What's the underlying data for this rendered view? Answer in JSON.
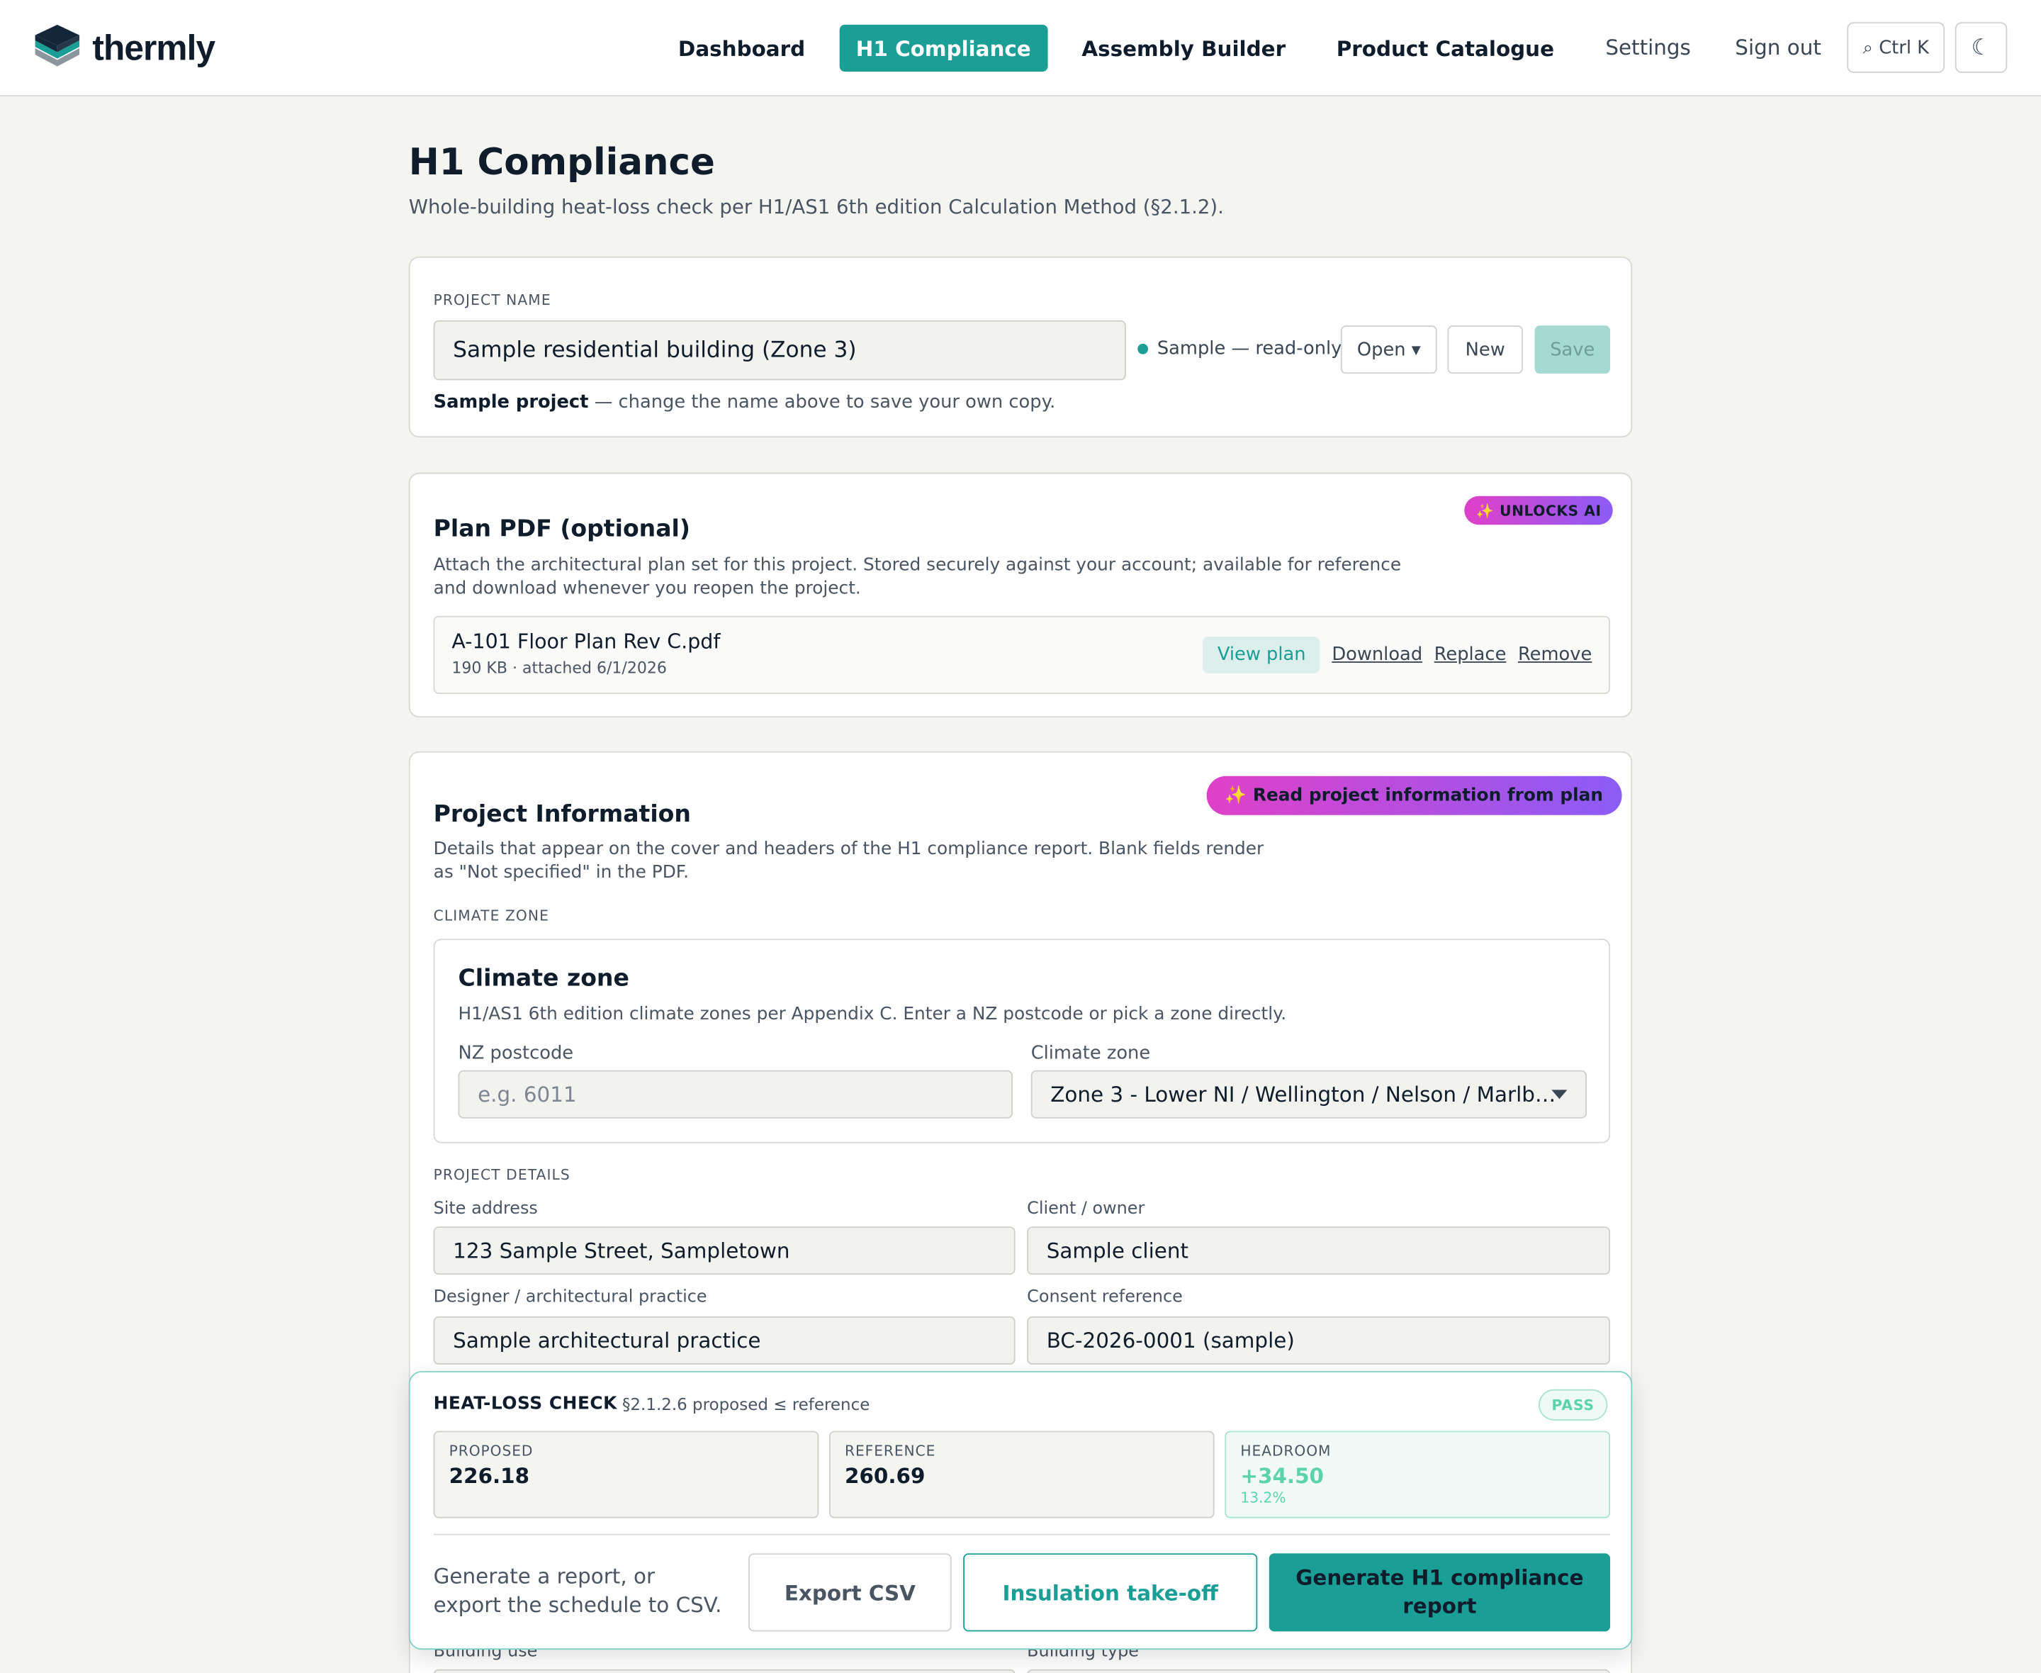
{
  "app": {
    "name": "thermly"
  },
  "nav": {
    "items": [
      "Dashboard",
      "H1 Compliance",
      "Assembly Builder",
      "Product Catalogue"
    ],
    "active": "H1 Compliance",
    "settings": "Settings",
    "sign_out": "Sign out",
    "search_shortcut": "⌕ Ctrl K",
    "theme_icon": "☾"
  },
  "page": {
    "title": "H1 Compliance",
    "subtitle": "Whole-building heat-loss check per H1/AS1 6th edition Calculation Method (§2.1.2)."
  },
  "project": {
    "label": "PROJECT NAME",
    "name_value": "Sample residential building (Zone 3)",
    "status": "Sample — read-only",
    "open_label": "Open ▾",
    "new_label": "New",
    "save_label": "Save",
    "note_bold": "Sample project",
    "note_rest": " — change the name above to save your own copy."
  },
  "plan": {
    "badge": "✨ UNLOCKS AI",
    "title": "Plan PDF (optional)",
    "description": "Attach the architectural plan set for this project. Stored securely against your account; available for reference and download whenever you reopen the project.",
    "file_name": "A-101 Floor Plan Rev C.pdf",
    "file_meta": "190 KB · attached 6/1/2026",
    "view_label": "View plan",
    "download_label": "Download",
    "replace_label": "Replace",
    "remove_label": "Remove"
  },
  "info": {
    "ai_button": "✨ Read project information from plan",
    "title": "Project Information",
    "description": "Details that appear on the cover and headers of the H1 compliance report. Blank fields render as \"Not specified\" in the PDF.",
    "climate_caps": "CLIMATE ZONE",
    "climate_title": "Climate zone",
    "climate_desc": "H1/AS1 6th edition climate zones per Appendix C. Enter a NZ postcode or pick a zone directly.",
    "postcode_label": "NZ postcode",
    "postcode_placeholder": "e.g. 6011",
    "zone_label": "Climate zone",
    "zone_value": "Zone 3 - Lower NI / Wellington / Nelson / Marlb…",
    "details_caps": "PROJECT DETAILS",
    "site_label": "Site address",
    "site_value": "123 Sample Street, Sampletown",
    "client_label": "Client / owner",
    "client_value": "Sample client",
    "designer_label": "Designer / architectural practice",
    "designer_value": "Sample architectural practice",
    "consent_label": "Consent reference",
    "consent_value": "BC-2026-0001 (sample)",
    "building_use_label": "Building use",
    "building_type_label": "Building type"
  },
  "heatloss": {
    "title": "HEAT-LOSS CHECK",
    "rule": "§2.1.2.6 proposed ≤ reference",
    "status": "PASS",
    "proposed_label": "PROPOSED",
    "proposed_value": "226.18",
    "reference_label": "REFERENCE",
    "reference_value": "260.69",
    "headroom_label": "HEADROOM",
    "headroom_value": "+34.50",
    "headroom_pct": "13.2%",
    "footer_text": "Generate a report, or export the schedule to CSV.",
    "export_label": "Export CSV",
    "takeoff_label": "Insulation take-off",
    "generate_label": "Generate H1 compliance report"
  },
  "colors": {
    "accent": "#1a9e95",
    "pass": "#5dd3ad",
    "ai_gradient_start": "#e040c8",
    "ai_gradient_end": "#8b5cf6"
  }
}
